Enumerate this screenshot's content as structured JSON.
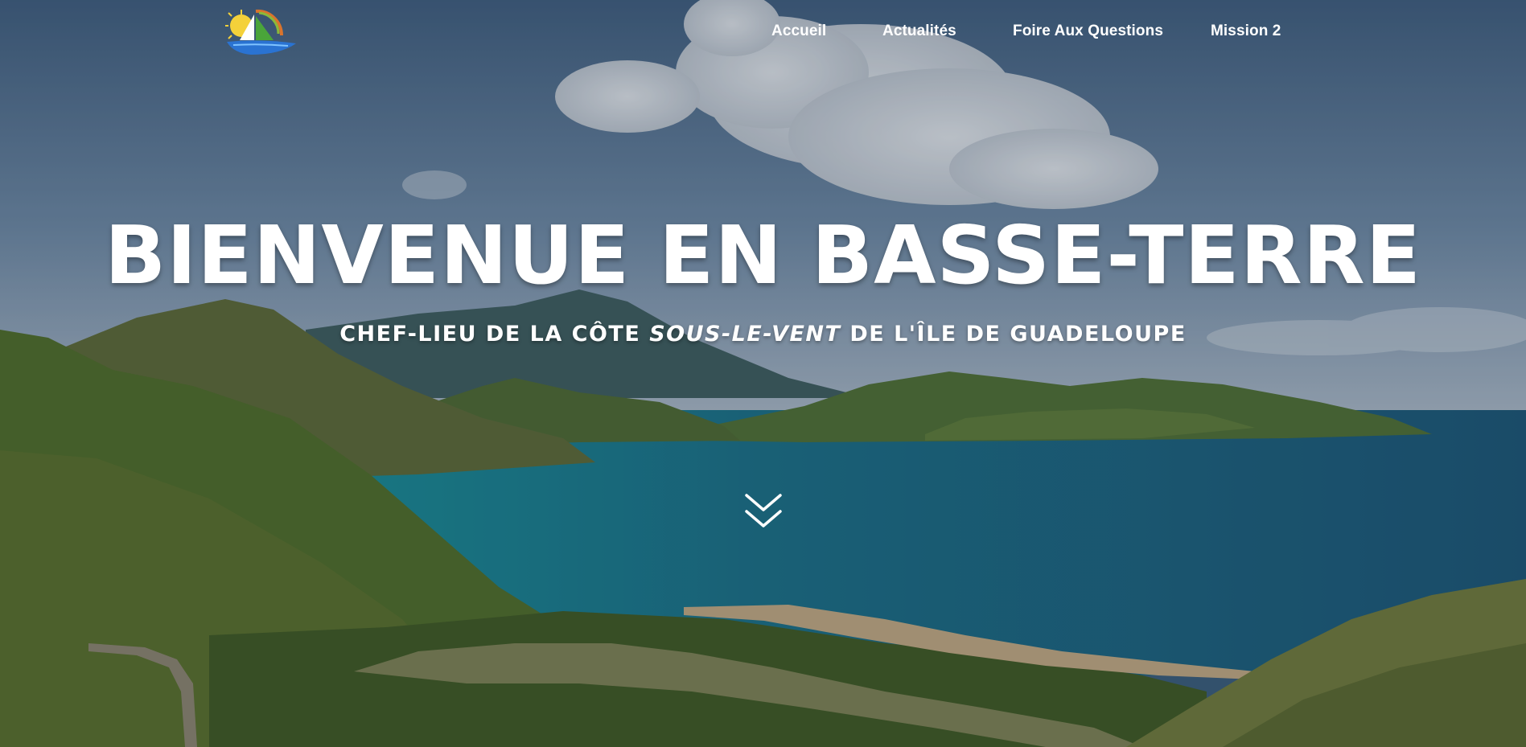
{
  "nav": {
    "items": [
      {
        "label": "Accueil"
      },
      {
        "label": "Actualités"
      },
      {
        "label": "Foire Aux Questions"
      },
      {
        "label": "Mission 2"
      }
    ]
  },
  "hero": {
    "title": "BIENVENUE EN BASSE-TERRE",
    "subtitle_before": "CHEF-LIEU DE LA CÔTE ",
    "subtitle_emphasis": "SOUS-LE-VENT",
    "subtitle_after": " DE L'ÎLE DE GUADELOUPE"
  },
  "icons": {
    "logo": "sailboat-logo-icon",
    "scroll": "chevron-double-down-icon"
  },
  "colors": {
    "sky": "#4d6f8f",
    "sea": "#1d7f8a",
    "hills": "#4f6b2c",
    "text": "#ffffff"
  }
}
